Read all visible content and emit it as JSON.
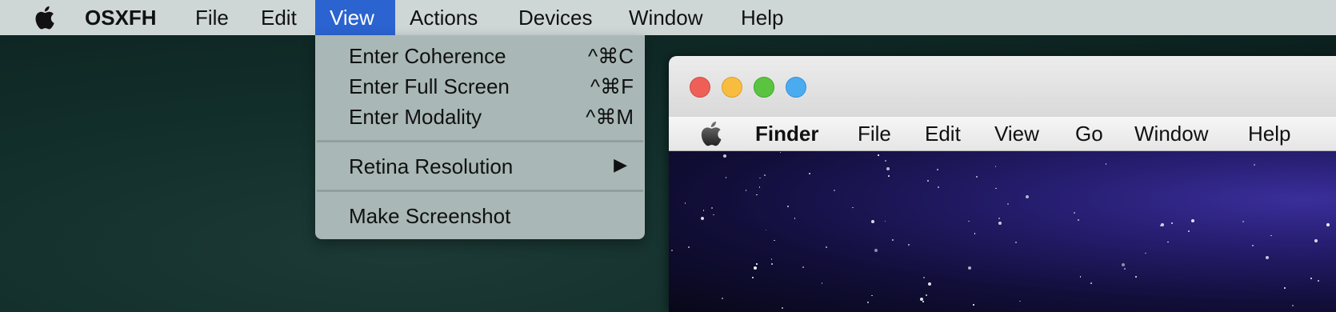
{
  "host_menubar": {
    "app_name": "OSXFH",
    "items": [
      "File",
      "Edit",
      "View",
      "Actions",
      "Devices",
      "Window",
      "Help"
    ],
    "active_item": "View",
    "accent_color": "#2b63d0"
  },
  "view_menu": {
    "items": [
      {
        "label": "Enter Coherence",
        "shortcut": "^⌘C"
      },
      {
        "label": "Enter Full Screen",
        "shortcut": "^⌘F"
      },
      {
        "label": "Enter Modality",
        "shortcut": "^⌘M"
      },
      {
        "label": "Retina Resolution",
        "submenu_icon": "▶"
      },
      {
        "label": "Make Screenshot"
      }
    ]
  },
  "guest_window": {
    "traffic_lights": [
      "#ee5f58",
      "#f8bd3e",
      "#5ac440",
      "#4aabf1"
    ],
    "menubar": {
      "app_name": "Finder",
      "items": [
        "File",
        "Edit",
        "View",
        "Go",
        "Window",
        "Help"
      ]
    }
  }
}
